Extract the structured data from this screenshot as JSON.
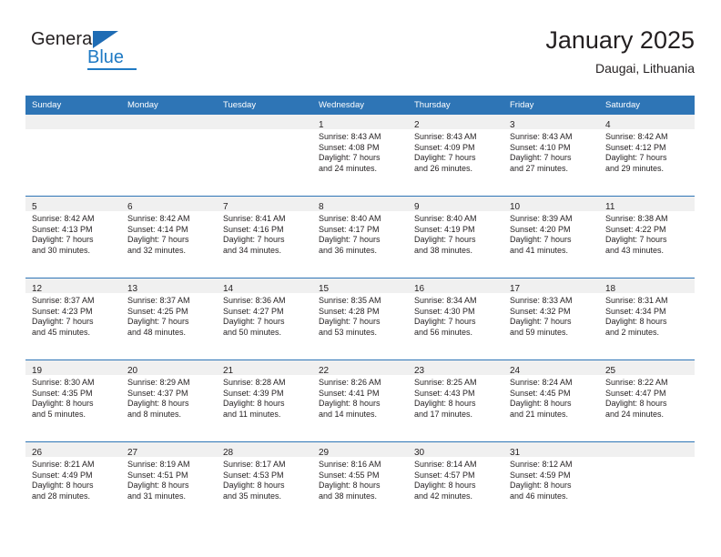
{
  "brand": {
    "name_part1": "General",
    "name_part2": "Blue"
  },
  "header": {
    "title": "January 2025",
    "subtitle": "Daugai, Lithuania"
  },
  "colors": {
    "header_blue": "#2E75B6",
    "date_band_gray": "#F0F0F0",
    "logo_blue": "#1F7AC4",
    "text": "#231F20"
  },
  "weekdays": [
    "Sunday",
    "Monday",
    "Tuesday",
    "Wednesday",
    "Thursday",
    "Friday",
    "Saturday"
  ],
  "labels": {
    "sunrise_prefix": "Sunrise:",
    "sunset_prefix": "Sunset:",
    "daylight_prefix": "Daylight:"
  },
  "weeks": [
    [
      {
        "day": "",
        "sunrise": "",
        "sunset": "",
        "daylight_line1": "",
        "daylight_line2": ""
      },
      {
        "day": "",
        "sunrise": "",
        "sunset": "",
        "daylight_line1": "",
        "daylight_line2": ""
      },
      {
        "day": "",
        "sunrise": "",
        "sunset": "",
        "daylight_line1": "",
        "daylight_line2": ""
      },
      {
        "day": "1",
        "sunrise": "Sunrise: 8:43 AM",
        "sunset": "Sunset: 4:08 PM",
        "daylight_line1": "Daylight: 7 hours",
        "daylight_line2": "and 24 minutes."
      },
      {
        "day": "2",
        "sunrise": "Sunrise: 8:43 AM",
        "sunset": "Sunset: 4:09 PM",
        "daylight_line1": "Daylight: 7 hours",
        "daylight_line2": "and 26 minutes."
      },
      {
        "day": "3",
        "sunrise": "Sunrise: 8:43 AM",
        "sunset": "Sunset: 4:10 PM",
        "daylight_line1": "Daylight: 7 hours",
        "daylight_line2": "and 27 minutes."
      },
      {
        "day": "4",
        "sunrise": "Sunrise: 8:42 AM",
        "sunset": "Sunset: 4:12 PM",
        "daylight_line1": "Daylight: 7 hours",
        "daylight_line2": "and 29 minutes."
      }
    ],
    [
      {
        "day": "5",
        "sunrise": "Sunrise: 8:42 AM",
        "sunset": "Sunset: 4:13 PM",
        "daylight_line1": "Daylight: 7 hours",
        "daylight_line2": "and 30 minutes."
      },
      {
        "day": "6",
        "sunrise": "Sunrise: 8:42 AM",
        "sunset": "Sunset: 4:14 PM",
        "daylight_line1": "Daylight: 7 hours",
        "daylight_line2": "and 32 minutes."
      },
      {
        "day": "7",
        "sunrise": "Sunrise: 8:41 AM",
        "sunset": "Sunset: 4:16 PM",
        "daylight_line1": "Daylight: 7 hours",
        "daylight_line2": "and 34 minutes."
      },
      {
        "day": "8",
        "sunrise": "Sunrise: 8:40 AM",
        "sunset": "Sunset: 4:17 PM",
        "daylight_line1": "Daylight: 7 hours",
        "daylight_line2": "and 36 minutes."
      },
      {
        "day": "9",
        "sunrise": "Sunrise: 8:40 AM",
        "sunset": "Sunset: 4:19 PM",
        "daylight_line1": "Daylight: 7 hours",
        "daylight_line2": "and 38 minutes."
      },
      {
        "day": "10",
        "sunrise": "Sunrise: 8:39 AM",
        "sunset": "Sunset: 4:20 PM",
        "daylight_line1": "Daylight: 7 hours",
        "daylight_line2": "and 41 minutes."
      },
      {
        "day": "11",
        "sunrise": "Sunrise: 8:38 AM",
        "sunset": "Sunset: 4:22 PM",
        "daylight_line1": "Daylight: 7 hours",
        "daylight_line2": "and 43 minutes."
      }
    ],
    [
      {
        "day": "12",
        "sunrise": "Sunrise: 8:37 AM",
        "sunset": "Sunset: 4:23 PM",
        "daylight_line1": "Daylight: 7 hours",
        "daylight_line2": "and 45 minutes."
      },
      {
        "day": "13",
        "sunrise": "Sunrise: 8:37 AM",
        "sunset": "Sunset: 4:25 PM",
        "daylight_line1": "Daylight: 7 hours",
        "daylight_line2": "and 48 minutes."
      },
      {
        "day": "14",
        "sunrise": "Sunrise: 8:36 AM",
        "sunset": "Sunset: 4:27 PM",
        "daylight_line1": "Daylight: 7 hours",
        "daylight_line2": "and 50 minutes."
      },
      {
        "day": "15",
        "sunrise": "Sunrise: 8:35 AM",
        "sunset": "Sunset: 4:28 PM",
        "daylight_line1": "Daylight: 7 hours",
        "daylight_line2": "and 53 minutes."
      },
      {
        "day": "16",
        "sunrise": "Sunrise: 8:34 AM",
        "sunset": "Sunset: 4:30 PM",
        "daylight_line1": "Daylight: 7 hours",
        "daylight_line2": "and 56 minutes."
      },
      {
        "day": "17",
        "sunrise": "Sunrise: 8:33 AM",
        "sunset": "Sunset: 4:32 PM",
        "daylight_line1": "Daylight: 7 hours",
        "daylight_line2": "and 59 minutes."
      },
      {
        "day": "18",
        "sunrise": "Sunrise: 8:31 AM",
        "sunset": "Sunset: 4:34 PM",
        "daylight_line1": "Daylight: 8 hours",
        "daylight_line2": "and 2 minutes."
      }
    ],
    [
      {
        "day": "19",
        "sunrise": "Sunrise: 8:30 AM",
        "sunset": "Sunset: 4:35 PM",
        "daylight_line1": "Daylight: 8 hours",
        "daylight_line2": "and 5 minutes."
      },
      {
        "day": "20",
        "sunrise": "Sunrise: 8:29 AM",
        "sunset": "Sunset: 4:37 PM",
        "daylight_line1": "Daylight: 8 hours",
        "daylight_line2": "and 8 minutes."
      },
      {
        "day": "21",
        "sunrise": "Sunrise: 8:28 AM",
        "sunset": "Sunset: 4:39 PM",
        "daylight_line1": "Daylight: 8 hours",
        "daylight_line2": "and 11 minutes."
      },
      {
        "day": "22",
        "sunrise": "Sunrise: 8:26 AM",
        "sunset": "Sunset: 4:41 PM",
        "daylight_line1": "Daylight: 8 hours",
        "daylight_line2": "and 14 minutes."
      },
      {
        "day": "23",
        "sunrise": "Sunrise: 8:25 AM",
        "sunset": "Sunset: 4:43 PM",
        "daylight_line1": "Daylight: 8 hours",
        "daylight_line2": "and 17 minutes."
      },
      {
        "day": "24",
        "sunrise": "Sunrise: 8:24 AM",
        "sunset": "Sunset: 4:45 PM",
        "daylight_line1": "Daylight: 8 hours",
        "daylight_line2": "and 21 minutes."
      },
      {
        "day": "25",
        "sunrise": "Sunrise: 8:22 AM",
        "sunset": "Sunset: 4:47 PM",
        "daylight_line1": "Daylight: 8 hours",
        "daylight_line2": "and 24 minutes."
      }
    ],
    [
      {
        "day": "26",
        "sunrise": "Sunrise: 8:21 AM",
        "sunset": "Sunset: 4:49 PM",
        "daylight_line1": "Daylight: 8 hours",
        "daylight_line2": "and 28 minutes."
      },
      {
        "day": "27",
        "sunrise": "Sunrise: 8:19 AM",
        "sunset": "Sunset: 4:51 PM",
        "daylight_line1": "Daylight: 8 hours",
        "daylight_line2": "and 31 minutes."
      },
      {
        "day": "28",
        "sunrise": "Sunrise: 8:17 AM",
        "sunset": "Sunset: 4:53 PM",
        "daylight_line1": "Daylight: 8 hours",
        "daylight_line2": "and 35 minutes."
      },
      {
        "day": "29",
        "sunrise": "Sunrise: 8:16 AM",
        "sunset": "Sunset: 4:55 PM",
        "daylight_line1": "Daylight: 8 hours",
        "daylight_line2": "and 38 minutes."
      },
      {
        "day": "30",
        "sunrise": "Sunrise: 8:14 AM",
        "sunset": "Sunset: 4:57 PM",
        "daylight_line1": "Daylight: 8 hours",
        "daylight_line2": "and 42 minutes."
      },
      {
        "day": "31",
        "sunrise": "Sunrise: 8:12 AM",
        "sunset": "Sunset: 4:59 PM",
        "daylight_line1": "Daylight: 8 hours",
        "daylight_line2": "and 46 minutes."
      },
      {
        "day": "",
        "sunrise": "",
        "sunset": "",
        "daylight_line1": "",
        "daylight_line2": ""
      }
    ]
  ]
}
